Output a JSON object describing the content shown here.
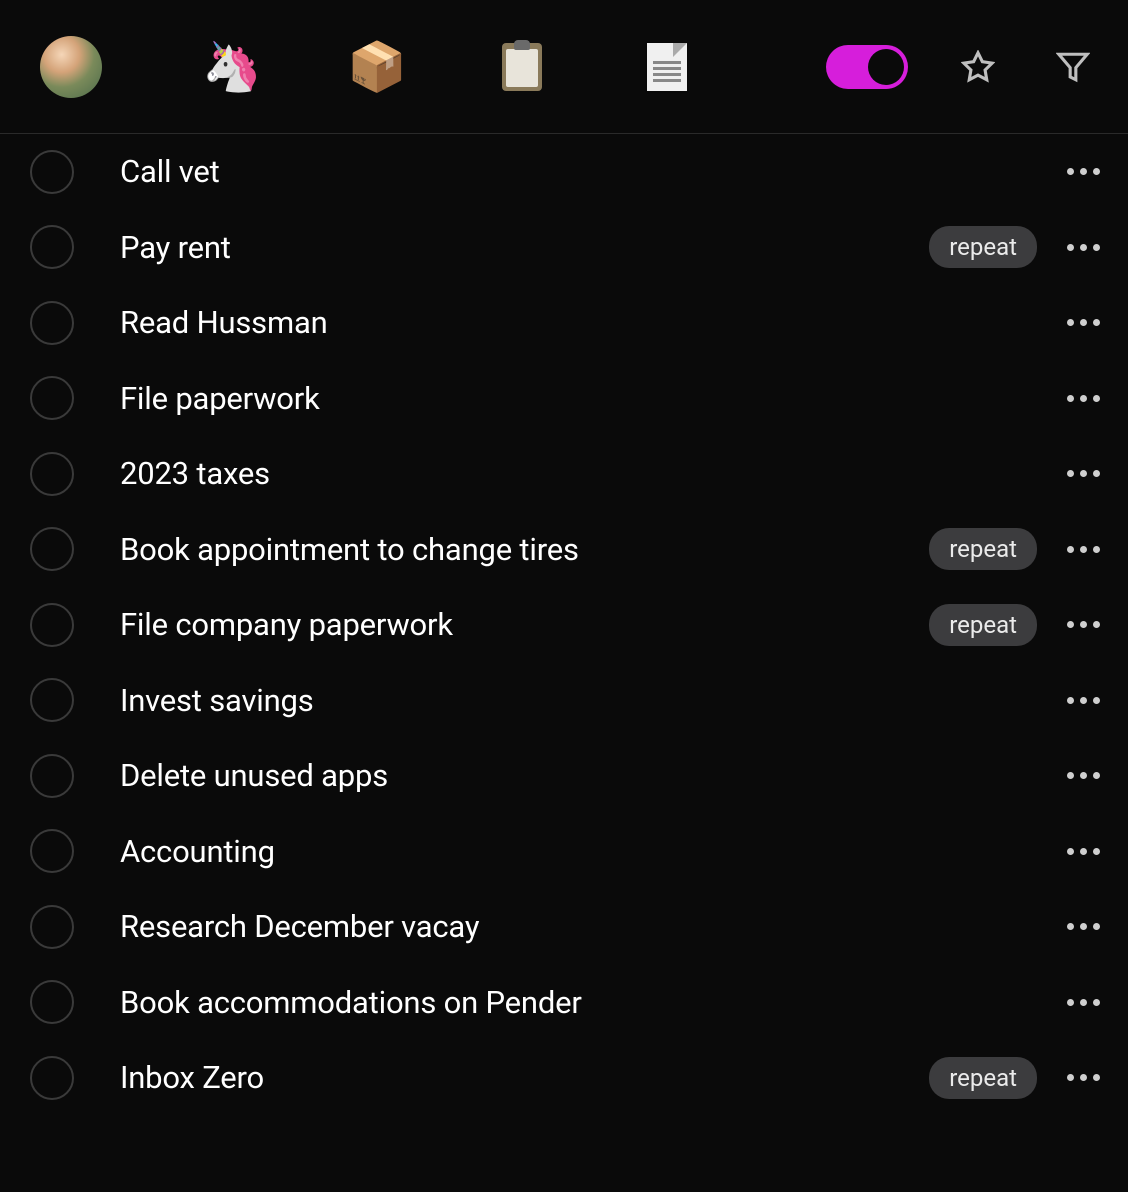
{
  "header": {
    "icons": {
      "unicorn": "🦄",
      "box": "📦"
    },
    "toggle_on": true
  },
  "repeat_label": "repeat",
  "tasks": [
    {
      "title": "Call vet",
      "repeat": false
    },
    {
      "title": "Pay rent",
      "repeat": true
    },
    {
      "title": "Read Hussman",
      "repeat": false
    },
    {
      "title": "File paperwork",
      "repeat": false
    },
    {
      "title": "2023 taxes",
      "repeat": false
    },
    {
      "title": "Book appointment to change tires",
      "repeat": true
    },
    {
      "title": "File company paperwork",
      "repeat": true
    },
    {
      "title": "Invest savings",
      "repeat": false
    },
    {
      "title": "Delete unused apps",
      "repeat": false
    },
    {
      "title": "Accounting",
      "repeat": false
    },
    {
      "title": "Research December vacay",
      "repeat": false
    },
    {
      "title": "Book accommodations on Pender",
      "repeat": false
    },
    {
      "title": "Inbox Zero",
      "repeat": true
    }
  ]
}
